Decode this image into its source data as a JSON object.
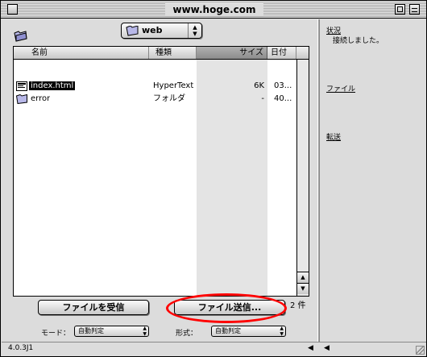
{
  "window": {
    "title": "www.hoge.com"
  },
  "path": {
    "folder": "web"
  },
  "list": {
    "columns": [
      "名前",
      "種類",
      "サイズ",
      "日付"
    ],
    "rows": [
      {
        "name": "index.html",
        "kind": "HyperText",
        "size": "6K",
        "date": "03...",
        "icon": "html-file-icon",
        "selected": true
      },
      {
        "name": "error",
        "kind": "フォルダ",
        "size": "-",
        "date": "40...",
        "icon": "folder-icon",
        "selected": false
      }
    ],
    "count": "2 件"
  },
  "buttons": {
    "receive": "ファイルを受信",
    "send": "ファイル送信..."
  },
  "mode": {
    "label": "モード：",
    "value": "自動判定"
  },
  "format": {
    "label": "形式：",
    "value": "自動判定"
  },
  "status": {
    "version": "4.0.3J1"
  },
  "side": {
    "status_label": "状況",
    "status_text": "接続しました。",
    "file_label": "ファイル",
    "transfer_label": "転送"
  },
  "colors": {
    "highlight": "#ff0000",
    "selection": "#000000"
  }
}
